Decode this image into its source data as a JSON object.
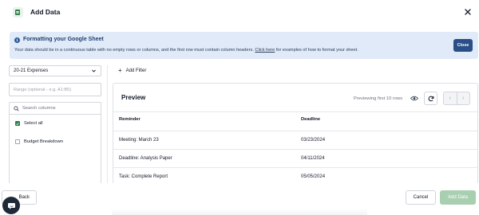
{
  "header": {
    "title": "Add Data",
    "logo_icon": "sheets-logo-icon",
    "close_icon": "close-icon"
  },
  "banner": {
    "title": "Formatting your Google Sheet",
    "text_before": "Your data should be in a continuous table with no empty rows or columns, and the first row must contain column headers. ",
    "link_text": "Click here",
    "text_after": " for examples of how to format your sheet.",
    "close_label": "Close",
    "bg_color": "#e0eaf8",
    "close_color": "#294f86"
  },
  "sidebar": {
    "sheet_selected": "20-21 Expenses",
    "range_placeholder": "Range (optional - e.g. A1:B5)",
    "search_placeholder": "Search columns",
    "select_all_label": "Select all",
    "select_all_checked": true,
    "columns": [
      {
        "label": "Budget Breakdown",
        "checked": false
      }
    ]
  },
  "filter": {
    "add_filter_label": "Add Filter"
  },
  "preview": {
    "title": "Preview",
    "count_text": "Previewing first 10 rows",
    "headers": [
      "Reminder",
      "Deadline"
    ],
    "rows": [
      [
        "Meeting: March 23",
        "03/23/2024"
      ],
      [
        "Deadline: Analysis Paper",
        "04/11/2024"
      ],
      [
        "Task: Complete Report",
        "05/05/2024"
      ]
    ]
  },
  "footer": {
    "back_label": "Back",
    "cancel_label": "Cancel",
    "add_label": "Add Data",
    "add_color": "#a9cfb1"
  },
  "colors": {
    "accent_green": "#2e7d4a",
    "chat_bubble": "#1f2937"
  }
}
